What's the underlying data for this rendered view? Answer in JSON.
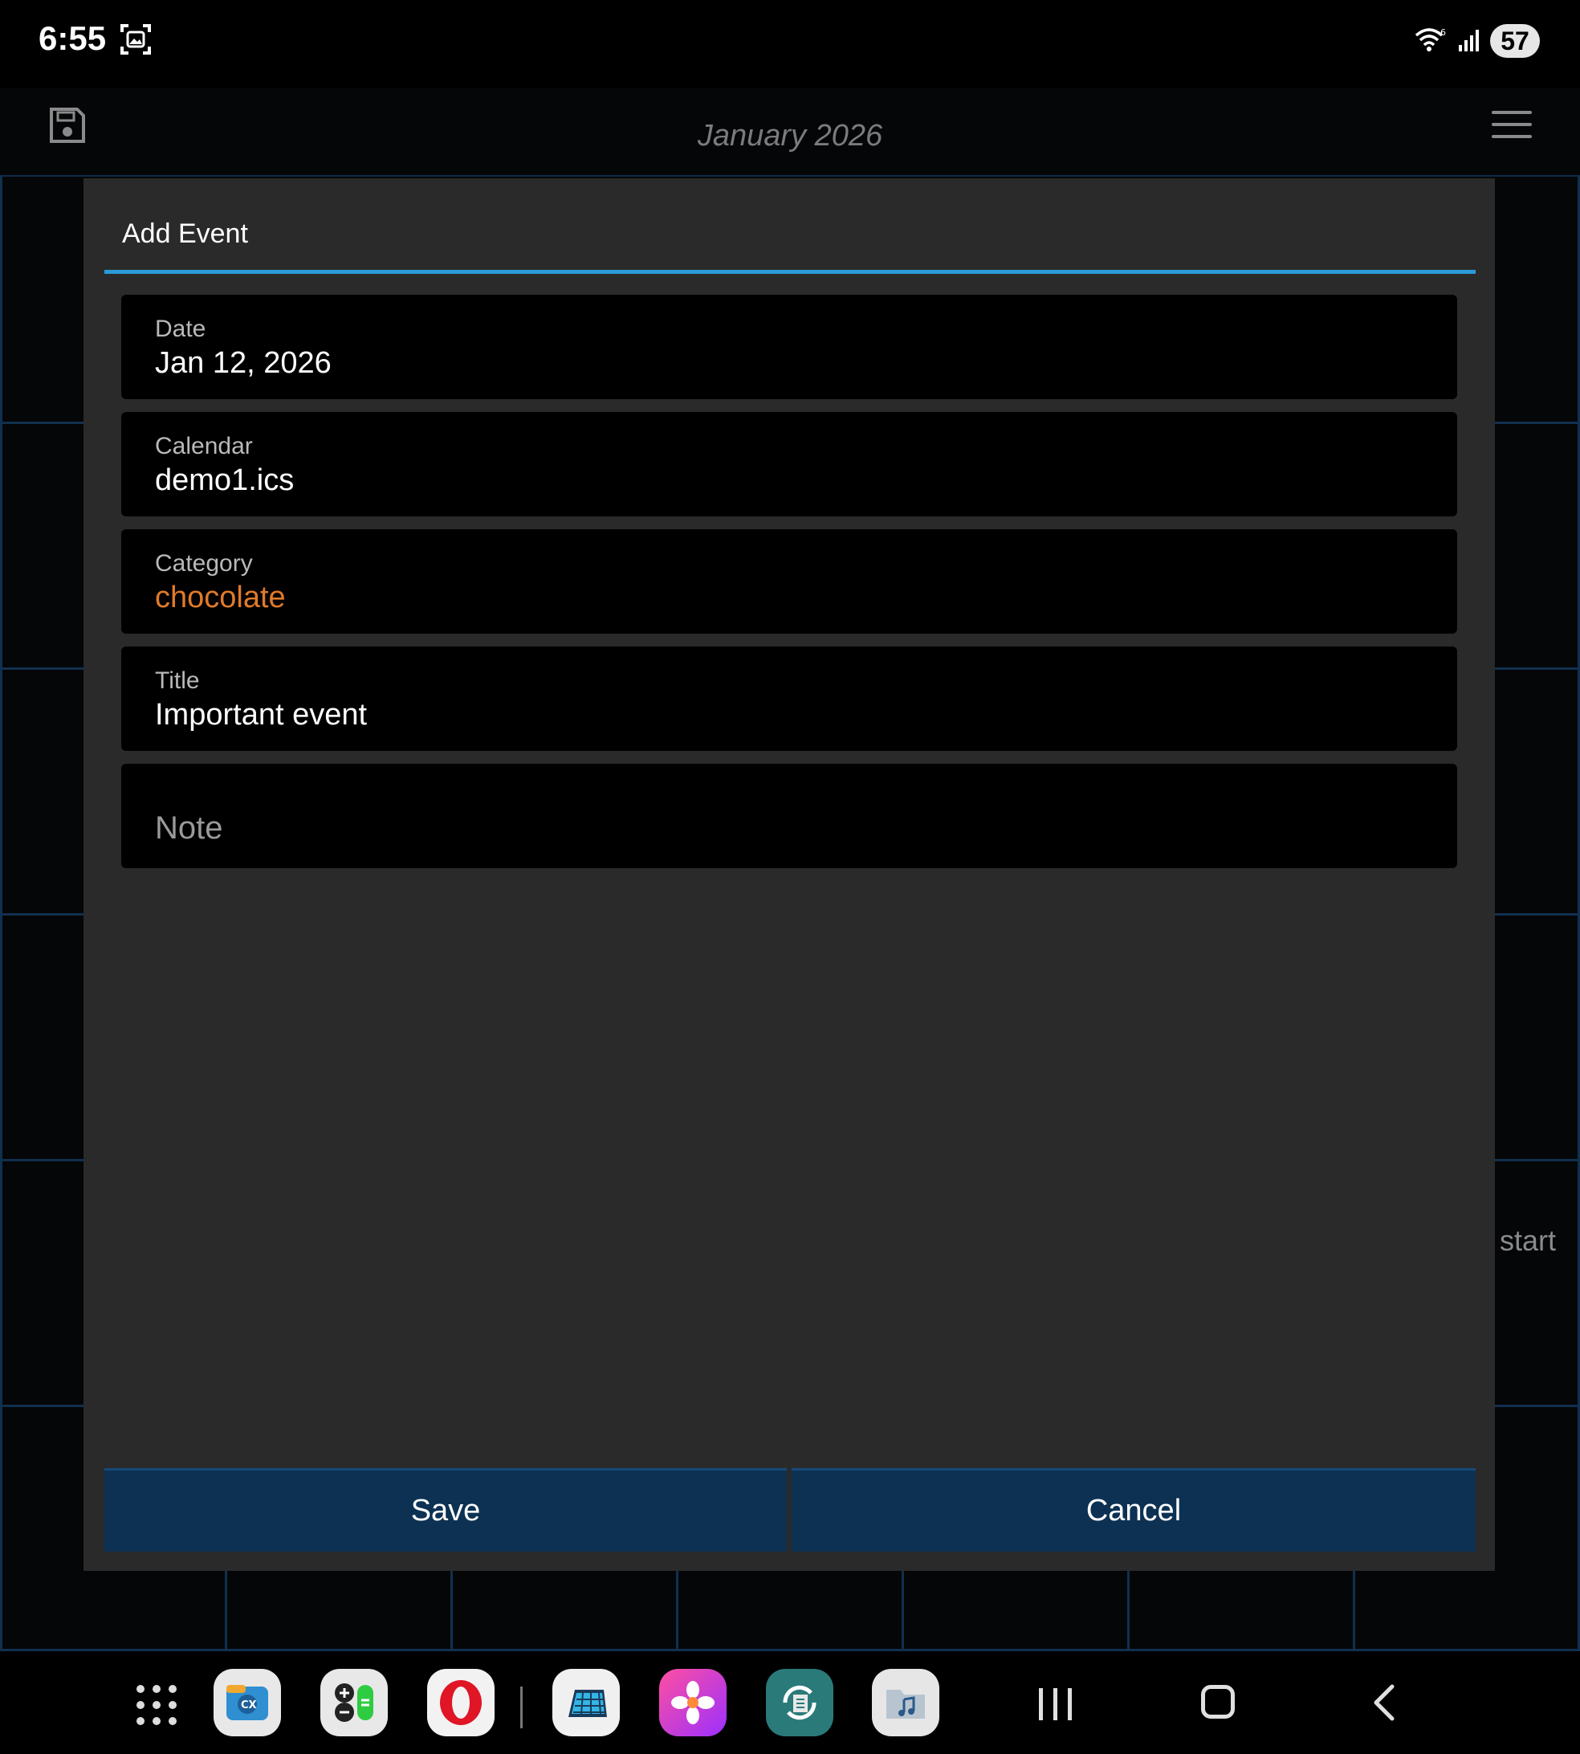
{
  "status_bar": {
    "time": "6:55",
    "battery": "57"
  },
  "app_bar": {
    "title": "January 2026"
  },
  "background": {
    "visible_text": "start"
  },
  "dialog": {
    "title": "Add Event",
    "fields": [
      {
        "label": "Date",
        "value": "Jan 12, 2026"
      },
      {
        "label": "Calendar",
        "value": "demo1.ics"
      },
      {
        "label": "Category",
        "value": "chocolate",
        "value_color": "#e07a2a"
      },
      {
        "label": "Title",
        "value": "Important event"
      }
    ],
    "note": {
      "placeholder": "Note"
    },
    "buttons": {
      "save": "Save",
      "cancel": "Cancel"
    }
  },
  "colors": {
    "accent": "#2b9ad8",
    "button_bg": "#0d3153",
    "dialog_bg": "#2a2a2a",
    "category": "#e07a2a"
  },
  "dock": {
    "apps": [
      "cx-file-explorer-icon",
      "calculator-icon",
      "opera-browser-icon",
      "calendar-app-icon",
      "photos-flower-icon",
      "sync-app-icon",
      "music-folder-icon"
    ]
  }
}
